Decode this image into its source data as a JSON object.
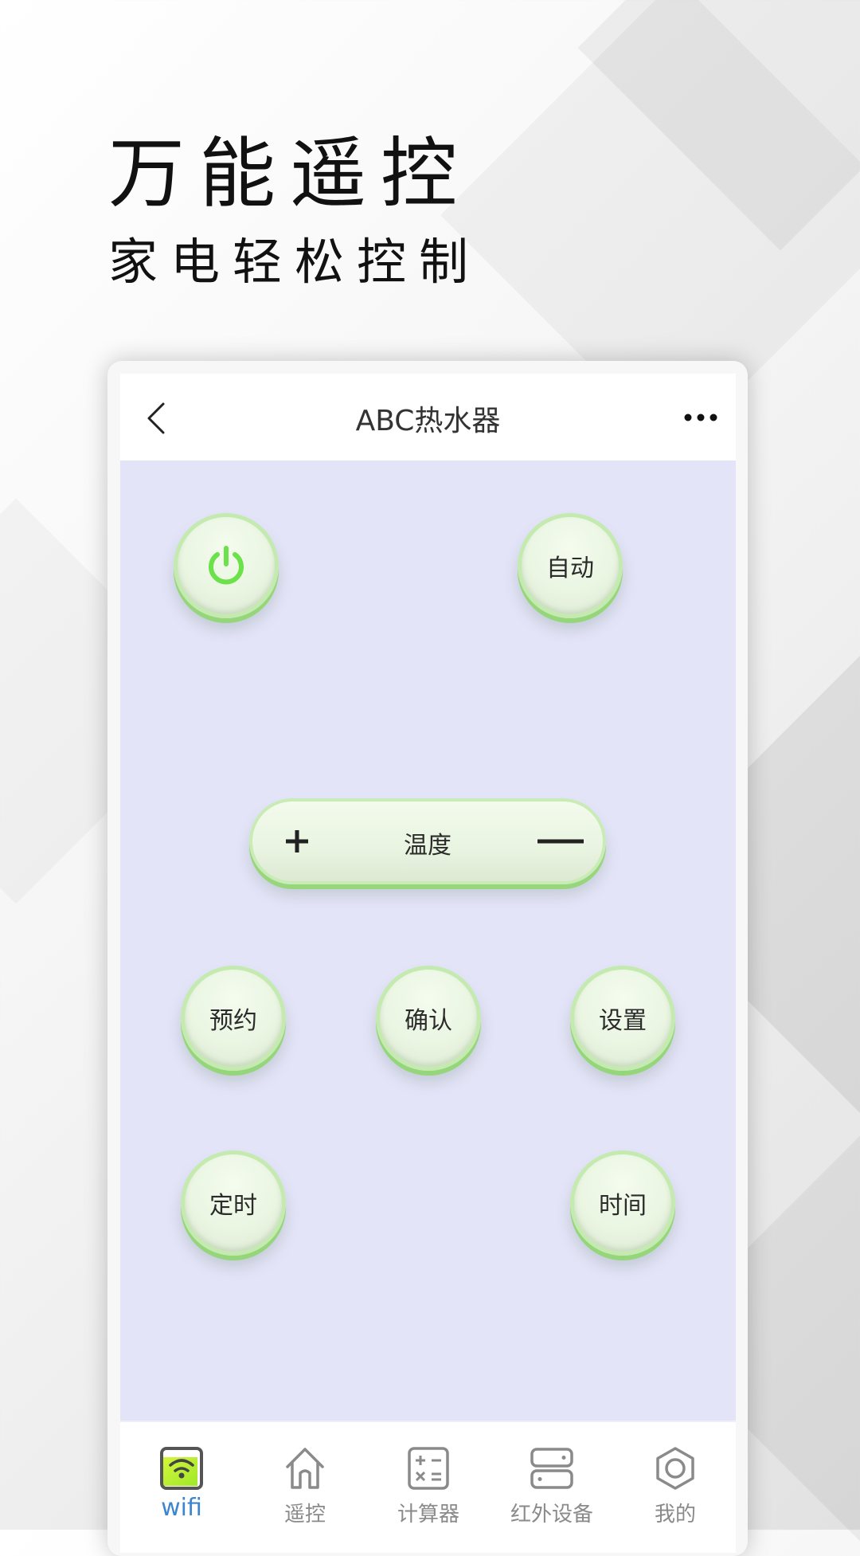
{
  "promo": {
    "headline": "万能遥控",
    "subline": "家电轻松控制"
  },
  "app": {
    "title": "ABC热水器",
    "back_icon": "chevron-left-icon",
    "more_icon": "more-horizontal-icon"
  },
  "controls": {
    "power": {
      "icon": "power-icon",
      "color": "#6be24a"
    },
    "auto": {
      "label": "自动"
    },
    "temperature": {
      "label": "温度",
      "increase_icon": "plus-icon",
      "decrease_icon": "minus-icon"
    },
    "reserve": {
      "label": "预约"
    },
    "confirm": {
      "label": "确认"
    },
    "settings": {
      "label": "设置"
    },
    "timer": {
      "label": "定时"
    },
    "time": {
      "label": "时间"
    }
  },
  "tabbar": {
    "items": [
      {
        "label": "wifi",
        "icon": "wifi-icon",
        "active": true
      },
      {
        "label": "遥控",
        "icon": "home-icon",
        "active": false
      },
      {
        "label": "计算器",
        "icon": "calculator-icon",
        "active": false
      },
      {
        "label": "红外设备",
        "icon": "server-icon",
        "active": false
      },
      {
        "label": "我的",
        "icon": "hexagon-nut-icon",
        "active": false
      }
    ],
    "active_color": "#3c86d0",
    "inactive_color": "#8a8a8a"
  },
  "colors": {
    "control_bg": "#e3e4f8",
    "button_accent": "#95d67b"
  }
}
